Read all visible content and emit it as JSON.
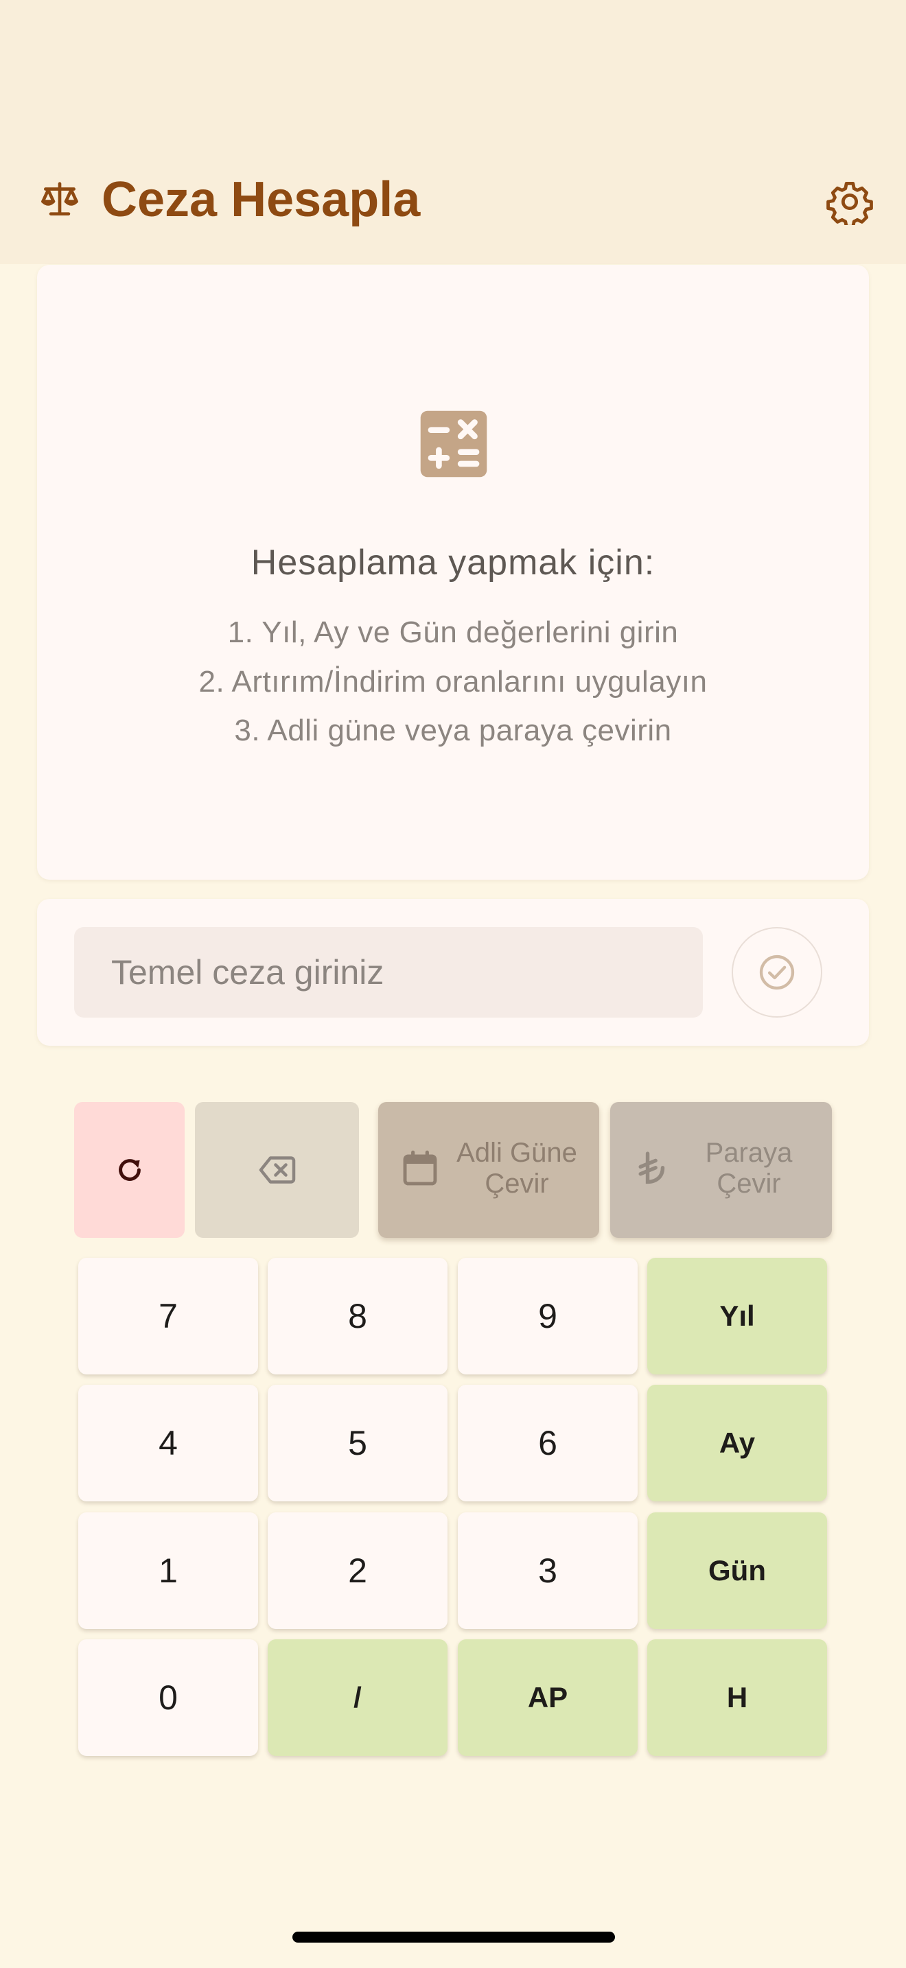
{
  "app_bar": {
    "title": "Ceza Hesapla",
    "logo_icon": "scale-balance-icon",
    "settings_icon": "gear-icon"
  },
  "instructions": {
    "icon": "calculator-icon",
    "heading": "Hesaplama yapmak için:",
    "steps": [
      "1. Yıl, Ay ve Gün değerlerini girin",
      "2. Artırım/İndirim oranlarını uygulayın",
      "3. Adli güne veya paraya çevirin"
    ]
  },
  "base_input": {
    "value": "",
    "placeholder": "Temel ceza giriniz",
    "confirm_icon": "check-circle-icon"
  },
  "actions": {
    "reset_icon": "refresh-icon",
    "backspace_icon": "backspace-icon",
    "convert_day": {
      "label": "Adli Güne\nÇevir",
      "icon": "calendar-icon"
    },
    "convert_money": {
      "label": "Paraya\nÇevir",
      "icon": "lira-icon"
    }
  },
  "keypad": {
    "rows": [
      [
        "7",
        "8",
        "9",
        "Yıl"
      ],
      [
        "4",
        "5",
        "6",
        "Ay"
      ],
      [
        "1",
        "2",
        "3",
        "Gün"
      ],
      [
        "0",
        "/",
        "AP",
        "H"
      ]
    ]
  },
  "colors": {
    "primary": "#8E4A12",
    "app_bar_bg": "#F9EEDA",
    "page_bg": "#FDF6E4",
    "unit_key_bg": "#DCE8B4",
    "reset_bg": "#FFDAD7"
  }
}
